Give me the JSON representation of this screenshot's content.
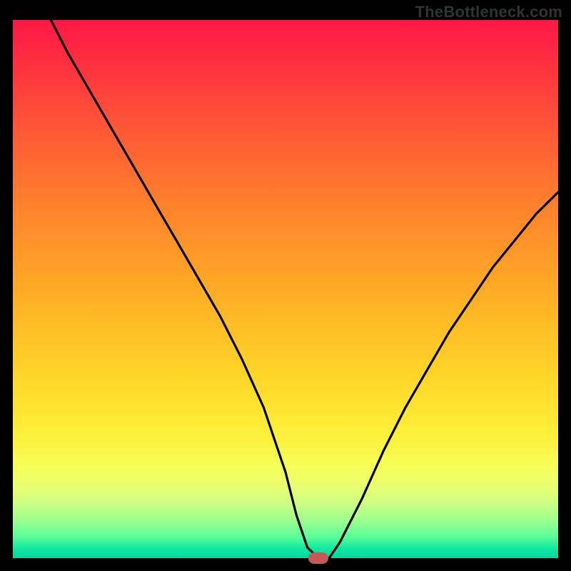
{
  "watermark": "TheBottleneck.com",
  "chart_data": {
    "type": "line",
    "title": "",
    "xlabel": "",
    "ylabel": "",
    "xlim": [
      0,
      100
    ],
    "ylim": [
      0,
      100
    ],
    "grid": false,
    "legend": false,
    "background_gradient": {
      "top_color": "#ff1846",
      "mid_color": "#ffd028",
      "bottom_color": "#00d7a1"
    },
    "series": [
      {
        "name": "bottleneck-curve",
        "x": [
          7,
          10,
          14,
          18,
          22,
          26,
          30,
          34,
          38,
          42,
          46,
          50,
          52,
          54,
          56,
          58,
          60,
          64,
          68,
          72,
          76,
          80,
          84,
          88,
          92,
          96,
          100
        ],
        "y": [
          100,
          94,
          87,
          80,
          73,
          66,
          59,
          52,
          45,
          37,
          28,
          16,
          8,
          2,
          0,
          0,
          3,
          11,
          20,
          28,
          35,
          42,
          48,
          54,
          59,
          64,
          68
        ],
        "color": "#000000"
      }
    ],
    "marker": {
      "x": 56,
      "y": 0,
      "color": "#c35a5a"
    }
  }
}
